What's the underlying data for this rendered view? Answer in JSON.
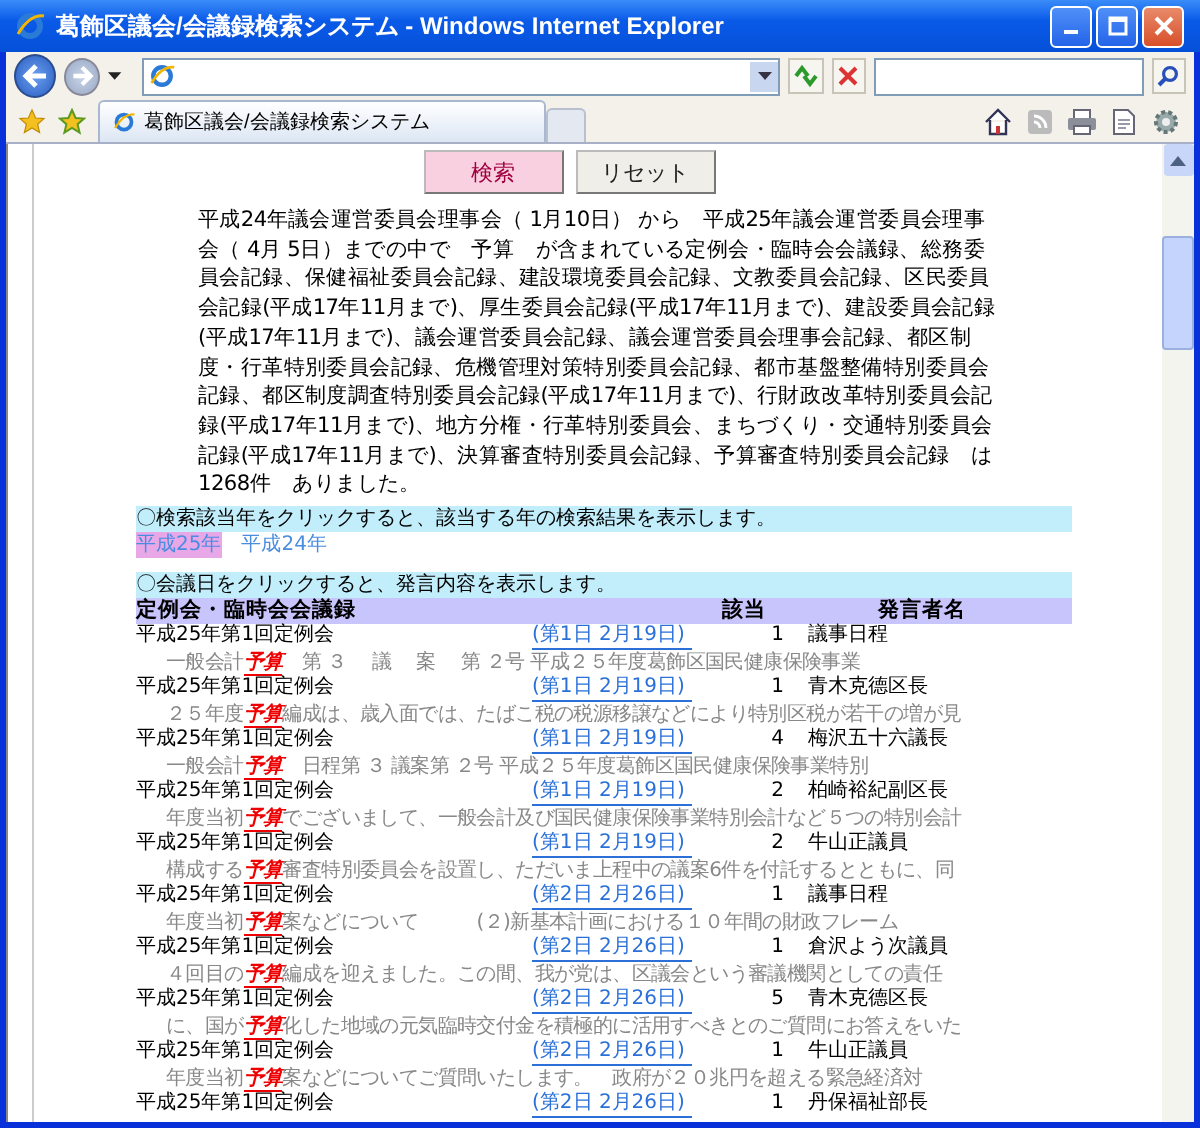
{
  "window": {
    "title": "葛飾区議会/会議録検索システム - Windows Internet Explorer"
  },
  "browser": {
    "tab_title": "葛飾区議会/会議録検索システム"
  },
  "buttons": [
    {
      "label": "検索",
      "kind": "primary"
    },
    {
      "label": "リセット",
      "kind": "secondary"
    }
  ],
  "summary": "平成24年議会運営委員会理事会（ 1月10日） から　平成25年議会運営委員会理事会（ 4月 5日）までの中で　予算　が含まれている定例会・臨時会会議録、総務委員会記録、保健福祉委員会記録、建設環境委員会記録、文教委員会記録、区民委員会記録(平成17年11月まで)、厚生委員会記録(平成17年11月まで)、建設委員会記録(平成17年11月まで)、議会運営委員会記録、議会運営委員会理事会記録、都区制度・行革特別委員会記録、危機管理対策特別委員会記録、都市基盤整備特別委員会記録、都区制度調査特別委員会記録(平成17年11月まで)、行財政改革特別委員会記録(平成17年11月まで)、地方分権・行革特別委員会、まちづくり・交通特別委員会記録(平成17年11月まで)、決算審査特別委員会記録、予算審査特別委員会記録　は1268件　ありました。",
  "year_hint": "〇検索該当年をクリックすると、該当する年の検索結果を表示します。",
  "years": [
    {
      "label": "平成25年",
      "selected": true
    },
    {
      "label": "平成24年",
      "selected": false
    }
  ],
  "meeting_hint": "〇会議日をクリックすると、発言内容を表示します。",
  "table": {
    "columns": [
      "定例会・臨時会会議録",
      "該当",
      "発言者名"
    ],
    "rows": [
      {
        "meeting": "平成25年第1回定例会",
        "date": "(第1日 2月19日)",
        "count": "1",
        "speaker": "議事日程",
        "before": "一般会計",
        "keyword": "予算",
        "after": "　第 ３　 議　 案　 第 ２号 平成２５年度葛飾区国民健康保険事業"
      },
      {
        "meeting": "平成25年第1回定例会",
        "date": "(第1日 2月19日)",
        "count": "1",
        "speaker": "青木克德区長",
        "before": "２５年度",
        "keyword": "予算",
        "after": "編成は、歳入面では、たばこ税の税源移譲などにより特別区税が若干の増が見"
      },
      {
        "meeting": "平成25年第1回定例会",
        "date": "(第1日 2月19日)",
        "count": "4",
        "speaker": "梅沢五十六議長",
        "before": "一般会計",
        "keyword": "予算",
        "after": "　日程第 ３ 議案第 ２号 平成２５年度葛飾区国民健康保険事業特別"
      },
      {
        "meeting": "平成25年第1回定例会",
        "date": "(第1日 2月19日)",
        "count": "2",
        "speaker": "柏崎裕紀副区長",
        "before": "年度当初",
        "keyword": "予算",
        "after": "でございまして、一般会計及び国民健康保険事業特別会計など５つの特別会計"
      },
      {
        "meeting": "平成25年第1回定例会",
        "date": "(第1日 2月19日)",
        "count": "2",
        "speaker": "牛山正議員",
        "before": "構成する",
        "keyword": "予算",
        "after": "審査特別委員会を設置し、ただいま上程中の議案6件を付託するとともに、同"
      },
      {
        "meeting": "平成25年第1回定例会",
        "date": "(第2日 2月26日)",
        "count": "1",
        "speaker": "議事日程",
        "before": "年度当初",
        "keyword": "予算",
        "after": "案などについて　　　(２)新基本計画における１０年間の財政フレーム"
      },
      {
        "meeting": "平成25年第1回定例会",
        "date": "(第2日 2月26日)",
        "count": "1",
        "speaker": "倉沢よう次議員",
        "before": "４回目の",
        "keyword": "予算",
        "after": "編成を迎えました。この間、我が党は、区議会という審議機関としての責任"
      },
      {
        "meeting": "平成25年第1回定例会",
        "date": "(第2日 2月26日)",
        "count": "5",
        "speaker": "青木克德区長",
        "before": "に、国が",
        "keyword": "予算",
        "after": "化した地域の元気臨時交付金を積極的に活用すべきとのご質問にお答えをいた"
      },
      {
        "meeting": "平成25年第1回定例会",
        "date": "(第2日 2月26日)",
        "count": "1",
        "speaker": "牛山正議員",
        "before": "年度当初",
        "keyword": "予算",
        "after": "案などについてご質問いたします。　政府が２０兆円を超える緊急経済対"
      },
      {
        "meeting": "平成25年第1回定例会",
        "date": "(第2日 2月26日)",
        "count": "1",
        "speaker": "丹保福祉部長"
      }
    ]
  }
}
